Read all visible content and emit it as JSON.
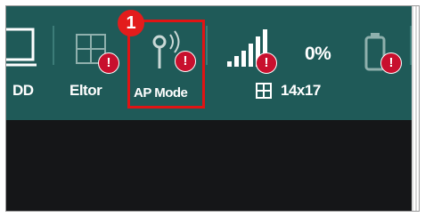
{
  "toolbar": {
    "items": [
      {
        "label": "DD",
        "icon": "drive-icon"
      },
      {
        "label": "Eltor",
        "icon": "elevator-grid-icon"
      },
      {
        "label": "AP Mode",
        "icon": "ap-antenna-icon"
      }
    ],
    "signal": {
      "icon": "signal-strength-icon"
    },
    "battery": {
      "percent": "0%",
      "icon": "battery-icon"
    },
    "grid": {
      "label": "14x17",
      "icon": "grid-icon"
    },
    "alert_symbol": "!"
  },
  "annotation": {
    "step_number": "1"
  },
  "colors": {
    "toolbar_bg": "#1f5a58",
    "content_bg": "#151618",
    "alert": "#c8102e",
    "highlight": "#e01414"
  }
}
